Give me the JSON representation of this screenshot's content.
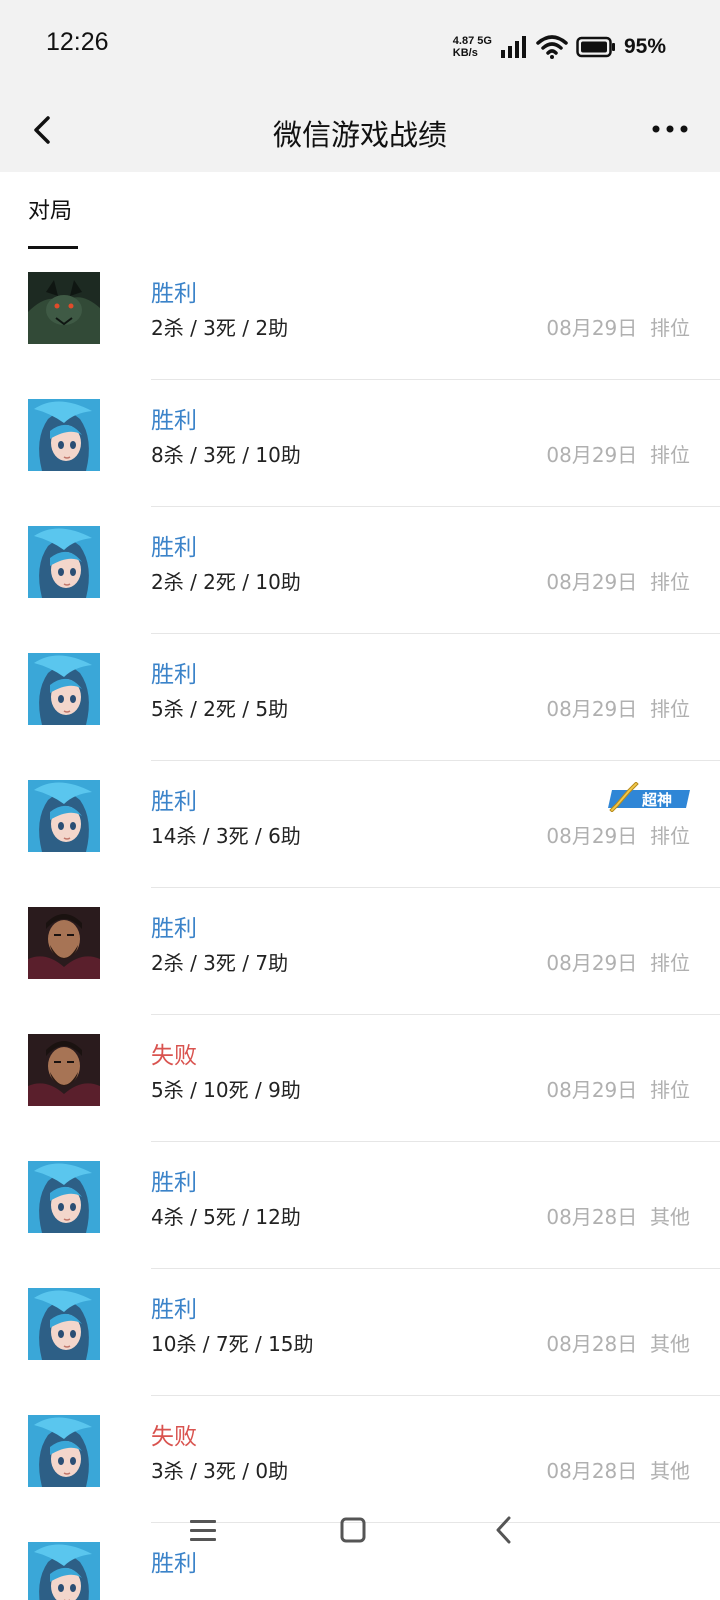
{
  "status_bar": {
    "time": "12:26",
    "net_speed_value": "4.87",
    "net_speed_unit": "KB/s",
    "network_type": "5G",
    "battery": "95%"
  },
  "header": {
    "title": "微信游戏战绩",
    "back_icon": "chevron-left-icon",
    "more_icon": "more-horizontal-icon"
  },
  "tabs": [
    {
      "label": "对局",
      "active": true
    }
  ],
  "matches": [
    {
      "result": "胜利",
      "status": "win",
      "kda": "2杀 / 3死 / 2助",
      "date": "08月29日",
      "mode": "排位",
      "hero": "dark-wolf",
      "badge": ""
    },
    {
      "result": "胜利",
      "status": "win",
      "kda": "8杀 / 3死 / 10助",
      "date": "08月29日",
      "mode": "排位",
      "hero": "blue-hair-girl",
      "badge": ""
    },
    {
      "result": "胜利",
      "status": "win",
      "kda": "2杀 / 2死 / 10助",
      "date": "08月29日",
      "mode": "排位",
      "hero": "blue-hair-girl",
      "badge": ""
    },
    {
      "result": "胜利",
      "status": "win",
      "kda": "5杀 / 2死 / 5助",
      "date": "08月29日",
      "mode": "排位",
      "hero": "blue-hair-girl",
      "badge": ""
    },
    {
      "result": "胜利",
      "status": "win",
      "kda": "14杀 / 3死 / 6助",
      "date": "08月29日",
      "mode": "排位",
      "hero": "blue-hair-girl",
      "badge": "超神"
    },
    {
      "result": "胜利",
      "status": "win",
      "kda": "2杀 / 3死 / 7助",
      "date": "08月29日",
      "mode": "排位",
      "hero": "bearded-man",
      "badge": ""
    },
    {
      "result": "失败",
      "status": "lose",
      "kda": "5杀 / 10死 / 9助",
      "date": "08月29日",
      "mode": "排位",
      "hero": "bearded-man",
      "badge": ""
    },
    {
      "result": "胜利",
      "status": "win",
      "kda": "4杀 / 5死 / 12助",
      "date": "08月28日",
      "mode": "其他",
      "hero": "blue-hair-girl",
      "badge": ""
    },
    {
      "result": "胜利",
      "status": "win",
      "kda": "10杀 / 7死 / 15助",
      "date": "08月28日",
      "mode": "其他",
      "hero": "blue-hair-girl",
      "badge": ""
    },
    {
      "result": "失败",
      "status": "lose",
      "kda": "3杀 / 3死 / 0助",
      "date": "08月28日",
      "mode": "其他",
      "hero": "blue-hair-girl",
      "badge": ""
    },
    {
      "result": "胜利",
      "status": "win",
      "kda": "",
      "date": "",
      "mode": "",
      "hero": "blue-hair-girl",
      "badge": ""
    }
  ],
  "nav_bar": {
    "menu_icon": "menu-icon",
    "home_icon": "home-square-icon",
    "back_icon": "back-arrow-icon"
  },
  "colors": {
    "win": "#3b83c9",
    "lose": "#d9534f",
    "meta": "#b0b0b0",
    "header_bg": "#f2f2f2"
  }
}
